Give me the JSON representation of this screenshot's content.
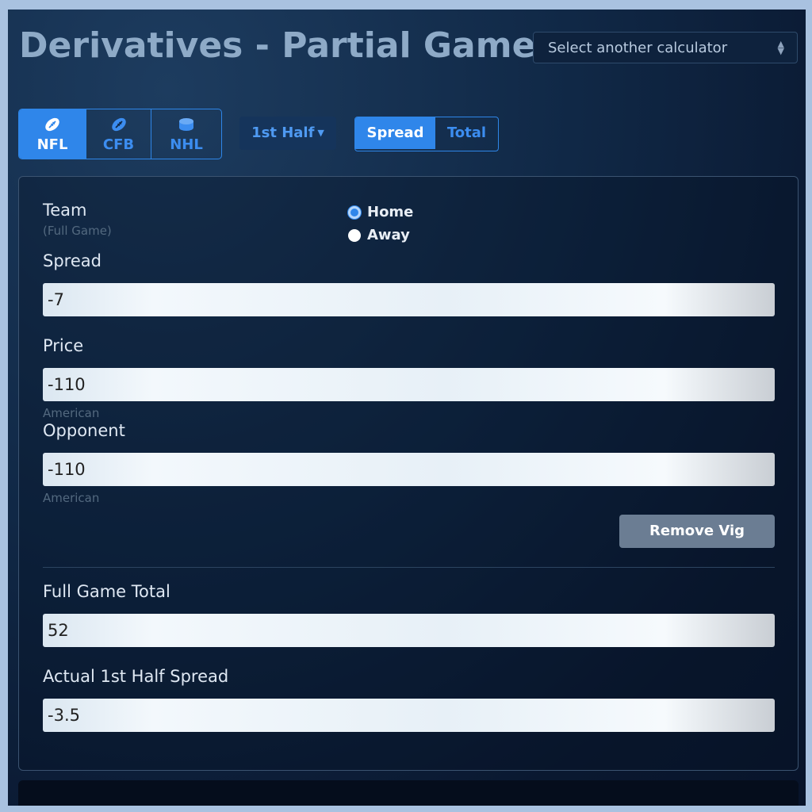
{
  "title": "Derivatives - Partial Game",
  "calculator_select": {
    "value": "Select another calculator"
  },
  "sports": [
    {
      "label": "NFL",
      "icon": "football-icon",
      "active": true
    },
    {
      "label": "CFB",
      "icon": "football-icon",
      "active": false
    },
    {
      "label": "NHL",
      "icon": "hockey-puck-icon",
      "active": false
    }
  ],
  "period": {
    "label": "1st Half"
  },
  "bet_types": [
    {
      "label": "Spread",
      "active": true
    },
    {
      "label": "Total",
      "active": false
    }
  ],
  "form": {
    "team_label": "Team",
    "team_sub": "(Full Game)",
    "home_label": "Home",
    "away_label": "Away",
    "selected_team": "Home",
    "spread_label": "Spread",
    "spread_value": "-7",
    "price_label": "Price",
    "price_value": "-110",
    "price_unit": "American",
    "opponent_label": "Opponent",
    "opponent_value": "-110",
    "opponent_unit": "American",
    "remove_vig_label": "Remove Vig",
    "full_total_label": "Full Game Total",
    "full_total_value": "52",
    "actual_spread_label": "Actual 1st Half Spread",
    "actual_spread_value": "-3.5"
  },
  "colors": {
    "accent": "#2f86ea",
    "title": "#8eaac7",
    "background": "#102846",
    "outer_border": "#a9c2e0",
    "remove_vig_button": "#6b7d93"
  }
}
